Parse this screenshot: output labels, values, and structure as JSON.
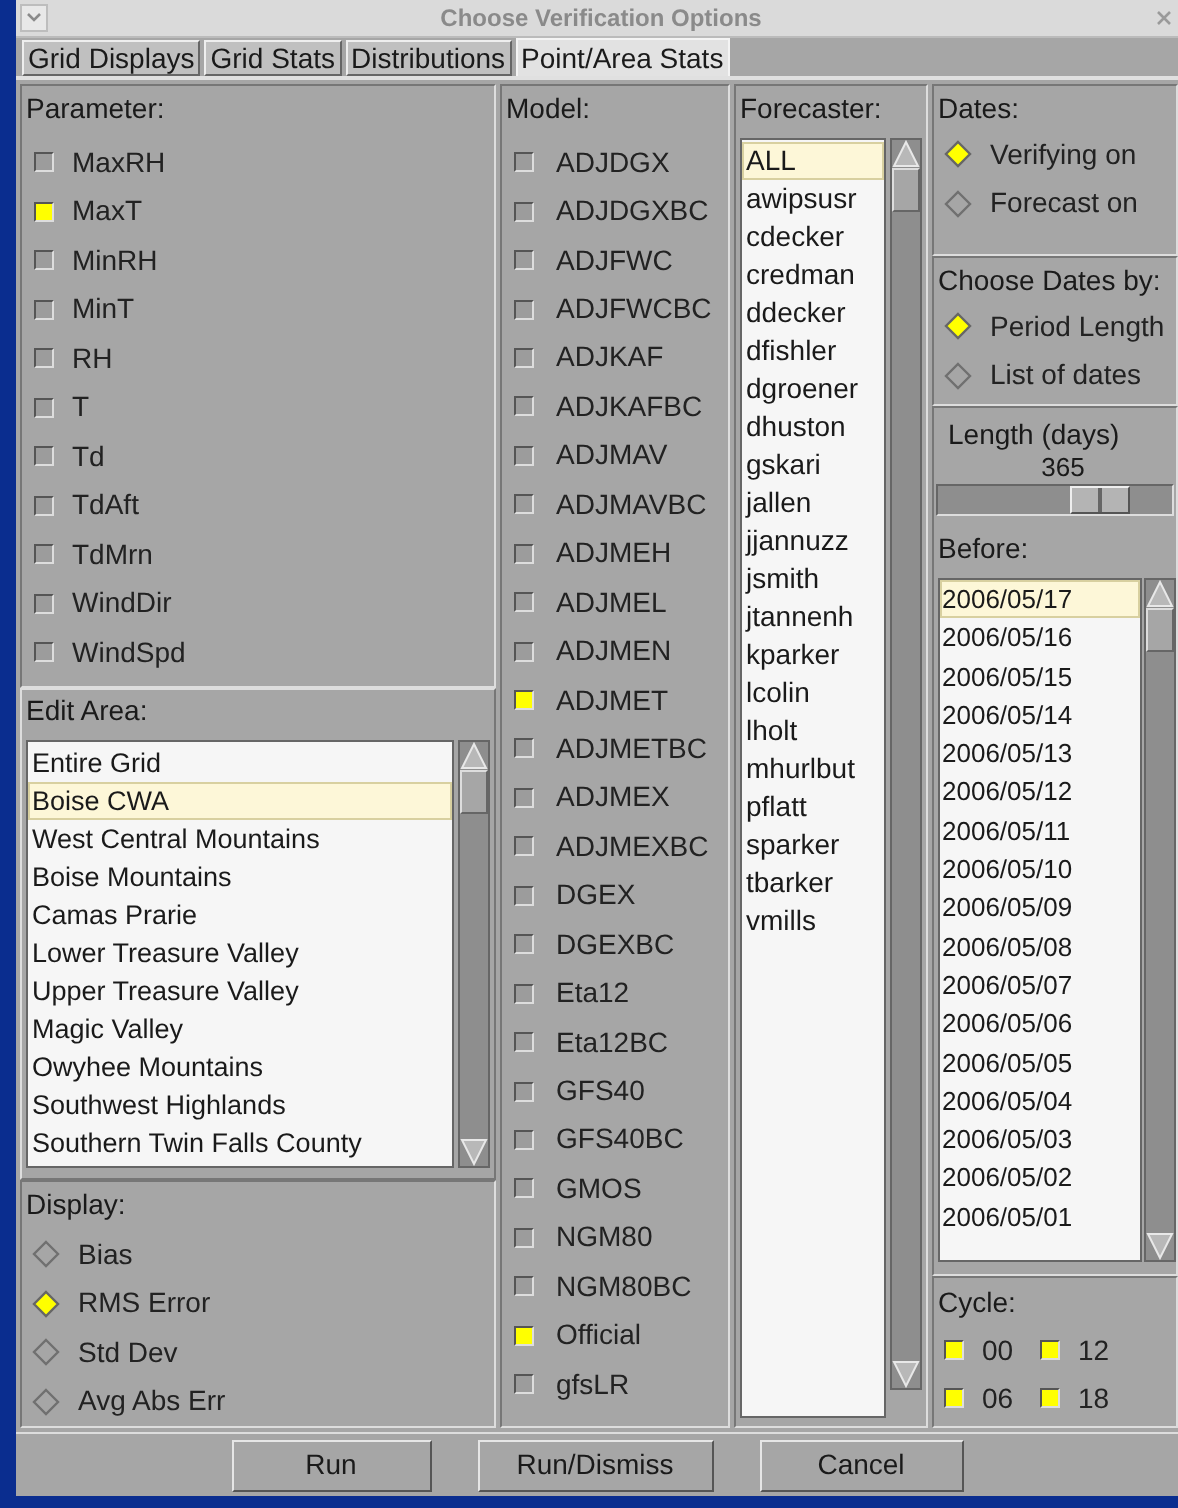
{
  "window": {
    "title": "Choose Verification Options"
  },
  "tabs": [
    {
      "label": "Grid Displays",
      "selected": false
    },
    {
      "label": "Grid Stats",
      "selected": false
    },
    {
      "label": "Distributions",
      "selected": false
    },
    {
      "label": "Point/Area Stats",
      "selected": true
    }
  ],
  "parameter": {
    "label": "Parameter:",
    "items": [
      {
        "label": "MaxRH",
        "checked": false
      },
      {
        "label": "MaxT",
        "checked": true
      },
      {
        "label": "MinRH",
        "checked": false
      },
      {
        "label": "MinT",
        "checked": false
      },
      {
        "label": "RH",
        "checked": false
      },
      {
        "label": "T",
        "checked": false
      },
      {
        "label": "Td",
        "checked": false
      },
      {
        "label": "TdAft",
        "checked": false
      },
      {
        "label": "TdMrn",
        "checked": false
      },
      {
        "label": "WindDir",
        "checked": false
      },
      {
        "label": "WindSpd",
        "checked": false
      }
    ]
  },
  "edit_area": {
    "label": "Edit Area:",
    "items": [
      {
        "label": "Entire Grid",
        "selected": false
      },
      {
        "label": "Boise CWA",
        "selected": true
      },
      {
        "label": "West Central Mountains",
        "selected": false
      },
      {
        "label": "Boise Mountains",
        "selected": false
      },
      {
        "label": "Camas Prarie",
        "selected": false
      },
      {
        "label": "Lower Treasure Valley",
        "selected": false
      },
      {
        "label": "Upper Treasure Valley",
        "selected": false
      },
      {
        "label": "Magic Valley",
        "selected": false
      },
      {
        "label": "Owyhee Mountains",
        "selected": false
      },
      {
        "label": "Southwest Highlands",
        "selected": false
      },
      {
        "label": "Southern Twin Falls County",
        "selected": false
      }
    ]
  },
  "display": {
    "label": "Display:",
    "options": [
      {
        "label": "Bias",
        "selected": false
      },
      {
        "label": "RMS Error",
        "selected": true
      },
      {
        "label": "Std Dev",
        "selected": false
      },
      {
        "label": "Avg Abs Err",
        "selected": false
      }
    ]
  },
  "model": {
    "label": "Model:",
    "items": [
      {
        "label": "ADJDGX",
        "checked": false
      },
      {
        "label": "ADJDGXBC",
        "checked": false
      },
      {
        "label": "ADJFWC",
        "checked": false
      },
      {
        "label": "ADJFWCBC",
        "checked": false
      },
      {
        "label": "ADJKAF",
        "checked": false
      },
      {
        "label": "ADJKAFBC",
        "checked": false
      },
      {
        "label": "ADJMAV",
        "checked": false
      },
      {
        "label": "ADJMAVBC",
        "checked": false
      },
      {
        "label": "ADJMEH",
        "checked": false
      },
      {
        "label": "ADJMEL",
        "checked": false
      },
      {
        "label": "ADJMEN",
        "checked": false
      },
      {
        "label": "ADJMET",
        "checked": true
      },
      {
        "label": "ADJMETBC",
        "checked": false
      },
      {
        "label": "ADJMEX",
        "checked": false
      },
      {
        "label": "ADJMEXBC",
        "checked": false
      },
      {
        "label": "DGEX",
        "checked": false
      },
      {
        "label": "DGEXBC",
        "checked": false
      },
      {
        "label": "Eta12",
        "checked": false
      },
      {
        "label": "Eta12BC",
        "checked": false
      },
      {
        "label": "GFS40",
        "checked": false
      },
      {
        "label": "GFS40BC",
        "checked": false
      },
      {
        "label": "GMOS",
        "checked": false
      },
      {
        "label": "NGM80",
        "checked": false
      },
      {
        "label": "NGM80BC",
        "checked": false
      },
      {
        "label": "Official",
        "checked": true
      },
      {
        "label": "gfsLR",
        "checked": false
      }
    ]
  },
  "forecaster": {
    "label": "Forecaster:",
    "items": [
      {
        "label": "ALL",
        "selected": true
      },
      {
        "label": "awipsusr",
        "selected": false
      },
      {
        "label": "cdecker",
        "selected": false
      },
      {
        "label": "credman",
        "selected": false
      },
      {
        "label": "ddecker",
        "selected": false
      },
      {
        "label": "dfishler",
        "selected": false
      },
      {
        "label": "dgroener",
        "selected": false
      },
      {
        "label": "dhuston",
        "selected": false
      },
      {
        "label": "gskari",
        "selected": false
      },
      {
        "label": "jallen",
        "selected": false
      },
      {
        "label": "jjannuzz",
        "selected": false
      },
      {
        "label": "jsmith",
        "selected": false
      },
      {
        "label": "jtannenh",
        "selected": false
      },
      {
        "label": "kparker",
        "selected": false
      },
      {
        "label": "lcolin",
        "selected": false
      },
      {
        "label": "lholt",
        "selected": false
      },
      {
        "label": "mhurlbut",
        "selected": false
      },
      {
        "label": "pflatt",
        "selected": false
      },
      {
        "label": "sparker",
        "selected": false
      },
      {
        "label": "tbarker",
        "selected": false
      },
      {
        "label": "vmills",
        "selected": false
      }
    ]
  },
  "dates": {
    "label": "Dates:",
    "options": [
      {
        "label": "Verifying on",
        "selected": true
      },
      {
        "label": "Forecast on",
        "selected": false
      }
    ]
  },
  "choose_dates_by": {
    "label": "Choose Dates by:",
    "options": [
      {
        "label": "Period Length",
        "selected": true
      },
      {
        "label": "List of dates",
        "selected": false
      }
    ]
  },
  "length": {
    "label": "Length (days)",
    "value": "365",
    "level": 0.69
  },
  "before": {
    "label": "Before:",
    "items": [
      {
        "label": "2006/05/17",
        "selected": true
      },
      {
        "label": "2006/05/16",
        "selected": false
      },
      {
        "label": "2006/05/15",
        "selected": false
      },
      {
        "label": "2006/05/14",
        "selected": false
      },
      {
        "label": "2006/05/13",
        "selected": false
      },
      {
        "label": "2006/05/12",
        "selected": false
      },
      {
        "label": "2006/05/11",
        "selected": false
      },
      {
        "label": "2006/05/10",
        "selected": false
      },
      {
        "label": "2006/05/09",
        "selected": false
      },
      {
        "label": "2006/05/08",
        "selected": false
      },
      {
        "label": "2006/05/07",
        "selected": false
      },
      {
        "label": "2006/05/06",
        "selected": false
      },
      {
        "label": "2006/05/05",
        "selected": false
      },
      {
        "label": "2006/05/04",
        "selected": false
      },
      {
        "label": "2006/05/03",
        "selected": false
      },
      {
        "label": "2006/05/02",
        "selected": false
      },
      {
        "label": "2006/05/01",
        "selected": false
      }
    ]
  },
  "cycle": {
    "label": "Cycle:",
    "items": [
      {
        "label": "00",
        "checked": true
      },
      {
        "label": "12",
        "checked": true
      },
      {
        "label": "06",
        "checked": true
      },
      {
        "label": "18",
        "checked": true
      }
    ]
  },
  "buttons": [
    "Run",
    "Run/Dismiss",
    "Cancel"
  ]
}
